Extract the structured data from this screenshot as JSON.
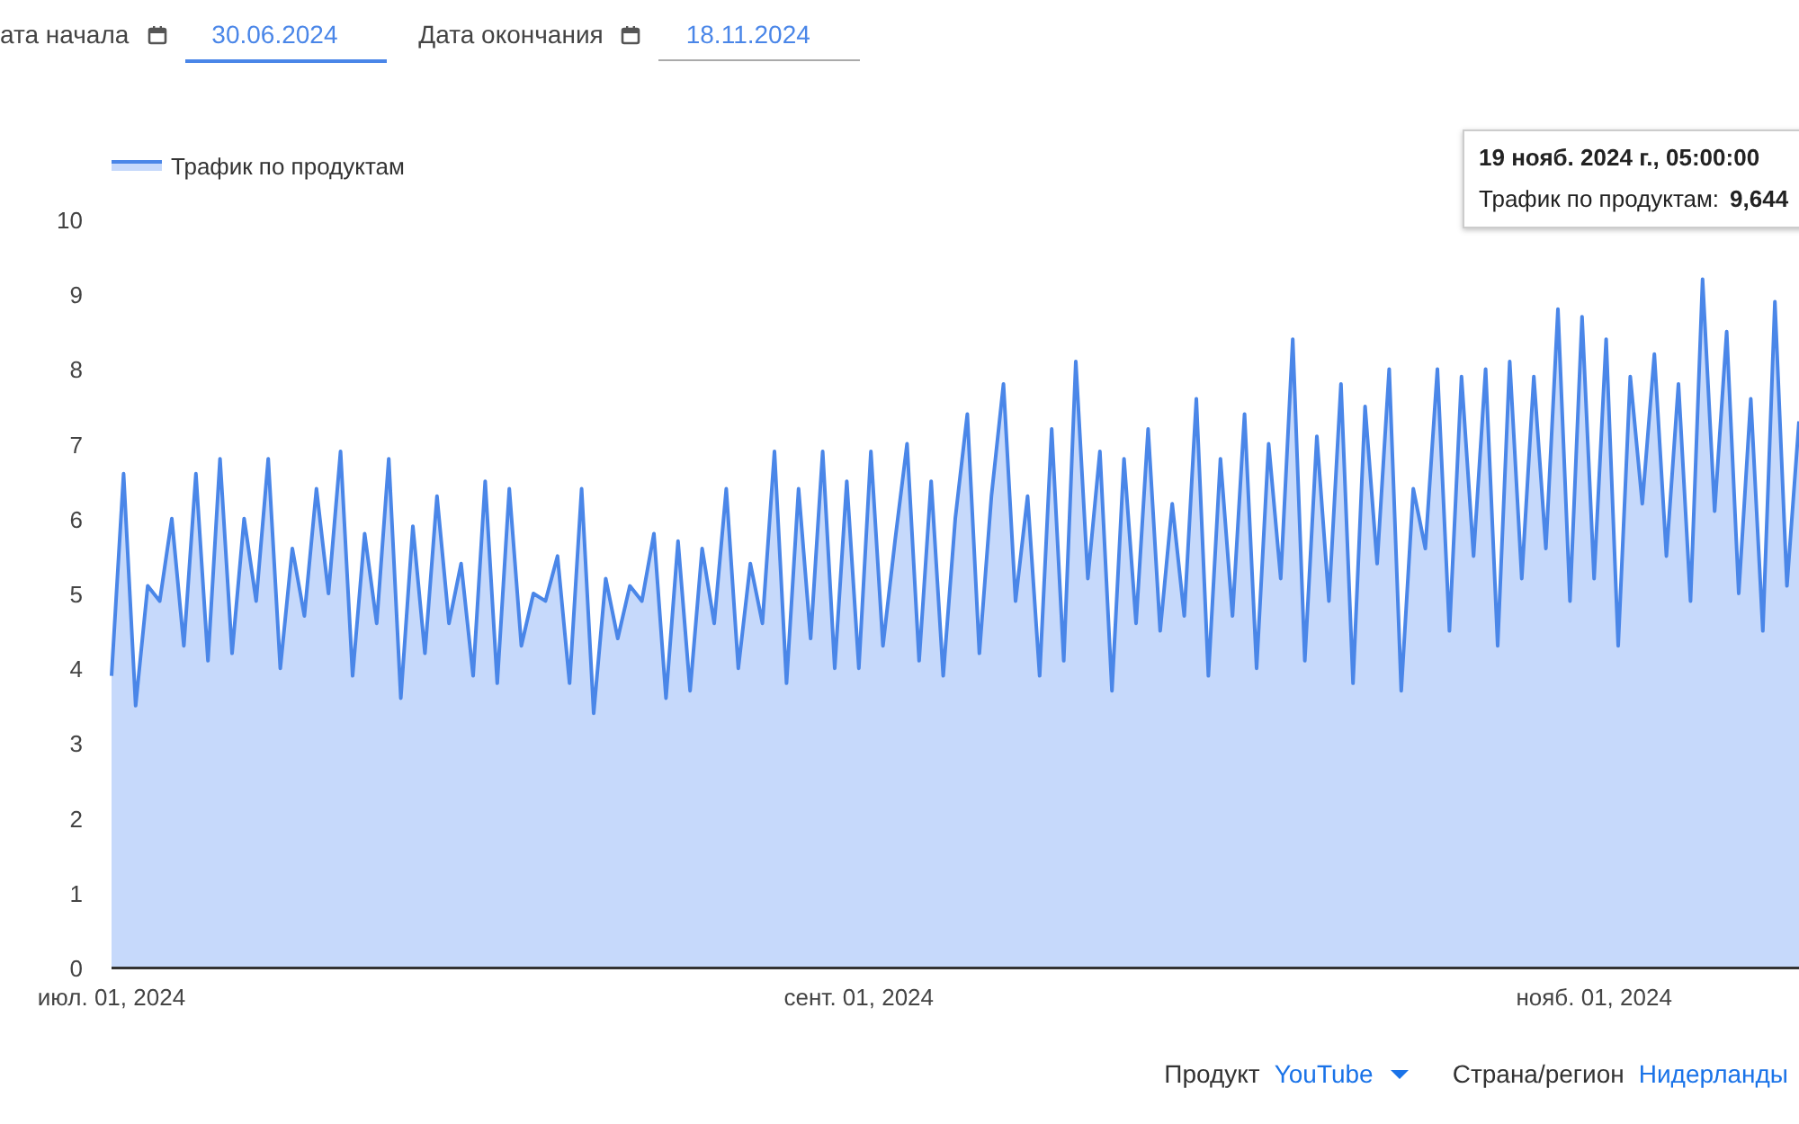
{
  "date_fields": [
    {
      "label": "ата начала",
      "value": "30.06.2024",
      "focused": true
    },
    {
      "label": "Дата окончания",
      "value": "18.11.2024",
      "focused": false
    }
  ],
  "chart": {
    "chart_data": {
      "type": "area",
      "series": [
        {
          "name": "Трафик по продуктам",
          "color": "#4a86e8",
          "values": [
            3.9,
            6.6,
            3.5,
            5.1,
            4.9,
            6.0,
            4.3,
            6.6,
            4.1,
            6.8,
            4.2,
            6.0,
            4.9,
            6.8,
            4.0,
            5.6,
            4.7,
            6.4,
            5.0,
            6.9,
            3.9,
            5.8,
            4.6,
            6.8,
            3.6,
            5.9,
            4.2,
            6.3,
            4.6,
            5.4,
            3.9,
            6.5,
            3.8,
            6.4,
            4.3,
            5.0,
            4.9,
            5.5,
            3.8,
            6.4,
            3.4,
            5.2,
            4.4,
            5.1,
            4.9,
            5.8,
            3.6,
            5.7,
            3.7,
            5.6,
            4.6,
            6.4,
            4.0,
            5.4,
            4.6,
            6.9,
            3.8,
            6.4,
            4.4,
            6.9,
            4.0,
            6.5,
            4.0,
            6.9,
            4.3,
            5.7,
            7.0,
            4.1,
            6.5,
            3.9,
            6.0,
            7.4,
            4.2,
            6.3,
            7.8,
            4.9,
            6.3,
            3.9,
            7.2,
            4.1,
            8.1,
            5.2,
            6.9,
            3.7,
            6.8,
            4.6,
            7.2,
            4.5,
            6.2,
            4.7,
            7.6,
            3.9,
            6.8,
            4.7,
            7.4,
            4.0,
            7.0,
            5.2,
            8.4,
            4.1,
            7.1,
            4.9,
            7.8,
            3.8,
            7.5,
            5.4,
            8.0,
            3.7,
            6.4,
            5.6,
            8.0,
            4.5,
            7.9,
            5.5,
            8.0,
            4.3,
            8.1,
            5.2,
            7.9,
            5.6,
            8.8,
            4.9,
            8.7,
            5.2,
            8.4,
            4.3,
            7.9,
            6.2,
            8.2,
            5.5,
            7.8,
            4.9,
            9.2,
            6.1,
            8.5,
            5.0,
            7.6,
            4.5,
            8.9,
            5.1,
            7.3
          ]
        }
      ],
      "categories": [
        "июл. 01, 2024",
        null,
        null,
        null,
        null,
        null,
        null,
        null,
        null,
        null,
        null,
        null,
        null,
        null,
        null,
        null,
        null,
        null,
        null,
        null,
        null,
        null,
        null,
        null,
        null,
        null,
        null,
        null,
        null,
        null,
        null,
        null,
        null,
        null,
        null,
        null,
        null,
        null,
        null,
        null,
        null,
        null,
        null,
        null,
        null,
        null,
        null,
        null,
        null,
        null,
        null,
        null,
        null,
        null,
        null,
        null,
        null,
        null,
        null,
        null,
        null,
        null,
        "сент. 01, 2024",
        null,
        null,
        null,
        null,
        null,
        null,
        null,
        null,
        null,
        null,
        null,
        null,
        null,
        null,
        null,
        null,
        null,
        null,
        null,
        null,
        null,
        null,
        null,
        null,
        null,
        null,
        null,
        null,
        null,
        null,
        null,
        null,
        null,
        null,
        null,
        null,
        null,
        null,
        null,
        null,
        null,
        null,
        null,
        null,
        null,
        null,
        null,
        null,
        null,
        null,
        null,
        null,
        null,
        null,
        null,
        null,
        null,
        null,
        null,
        null,
        "нояб. 01, 2024",
        null,
        null,
        null,
        null,
        null,
        null,
        null,
        null,
        null,
        null,
        null,
        null,
        null,
        null,
        null,
        null,
        null
      ],
      "ylim": [
        0,
        10
      ],
      "yticks": [
        0,
        1,
        2,
        3,
        4,
        5,
        6,
        7,
        8,
        9,
        10
      ]
    },
    "tooltip": {
      "title": "19 нояб. 2024 г., 05:00:00",
      "label": "Трафик по продуктам:",
      "value": "9,644"
    }
  },
  "filters": [
    {
      "label": "Продукт",
      "value": "YouTube"
    },
    {
      "label": "Страна/регион",
      "value": "Нидерланды"
    }
  ]
}
